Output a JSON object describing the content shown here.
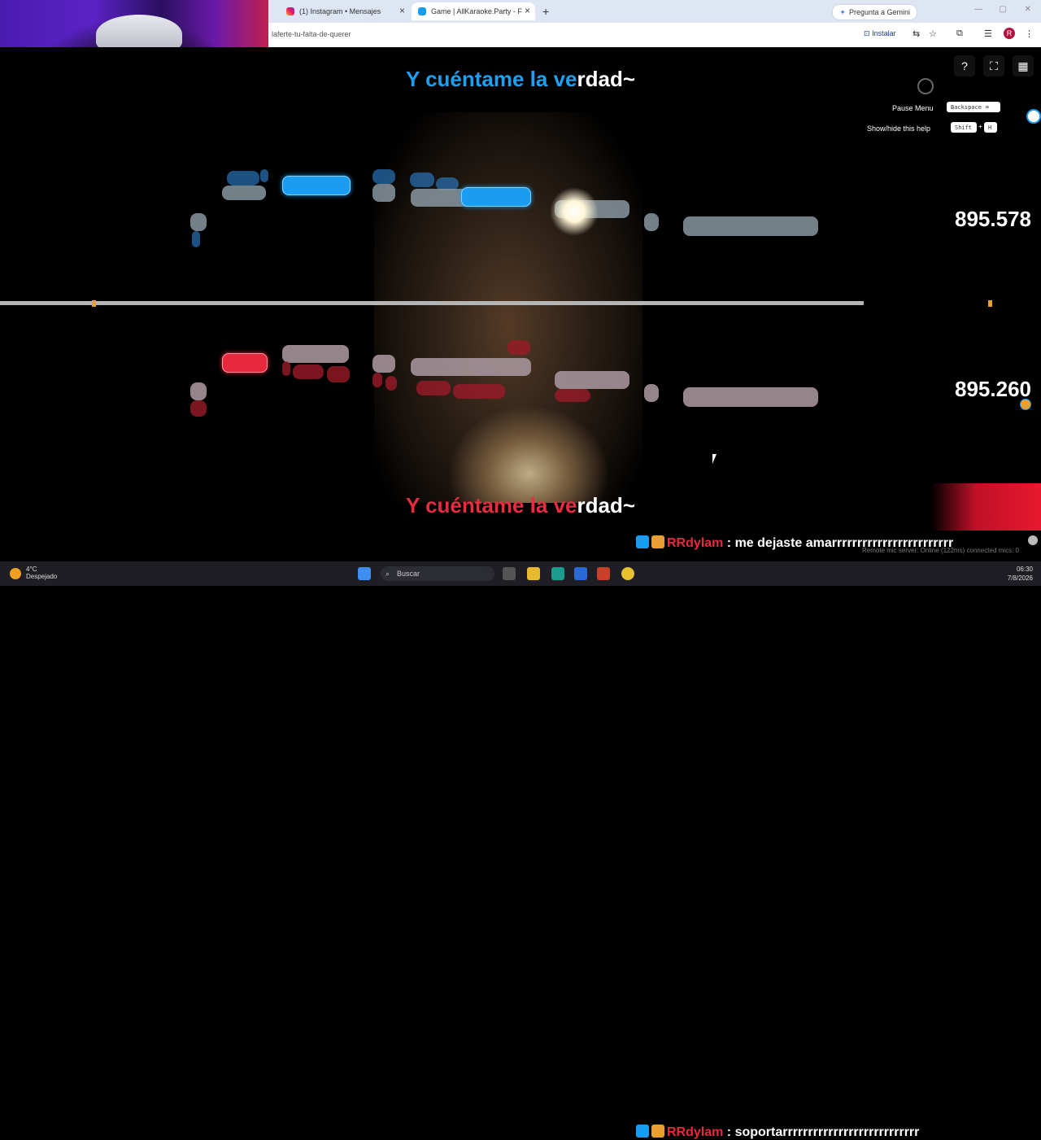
{
  "browser": {
    "tabs": [
      {
        "label": "(1) Instagram • Mensajes",
        "icon": "instagram-icon",
        "active": false
      },
      {
        "label": "Game | AllKaraoke.Party - F",
        "icon": "allkaraoke-icon",
        "active": true
      }
    ],
    "gemini_label": "Pregunta a Gemini",
    "url": "laferte-tu-falta-de-querer",
    "install_label": "Instalar",
    "avatar_letter": "R"
  },
  "game": {
    "lyric_top": {
      "sung": "Y cuéntame la ve",
      "rest": "rdad~"
    },
    "lyric_bottom": {
      "sung": "Y cuéntame la ve",
      "rest": "rdad~"
    },
    "score_p1": "895.578",
    "score_p2": "895.260",
    "help": {
      "pause_label": "Pause Menu",
      "pause_key": "Backspace ⌫",
      "toggle_help_label": "Show/hide this help",
      "toggle_key1": "Shift",
      "toggle_key_sep": "+",
      "toggle_key2": "H"
    },
    "colors": {
      "player1": "#1a9df0",
      "player2": "#e8293d"
    }
  },
  "chat": {
    "line1": {
      "name": "RRdylam",
      "message": " : me dejaste amarrrrrrrrrrrrrrrrrrrrrrrr"
    },
    "line2": {
      "name": "RRdylam",
      "message": " : soportarrrrrrrrrrrrrrrrrrrrrrrrrrr"
    }
  },
  "remote_status": "Remote mic server: Online (122ms)   connected mics: 0",
  "taskbar": {
    "weather_temp": "4°C",
    "weather_text": "Despejado",
    "search_placeholder": "Buscar",
    "time": "06:30",
    "date": "7/8/2026"
  }
}
